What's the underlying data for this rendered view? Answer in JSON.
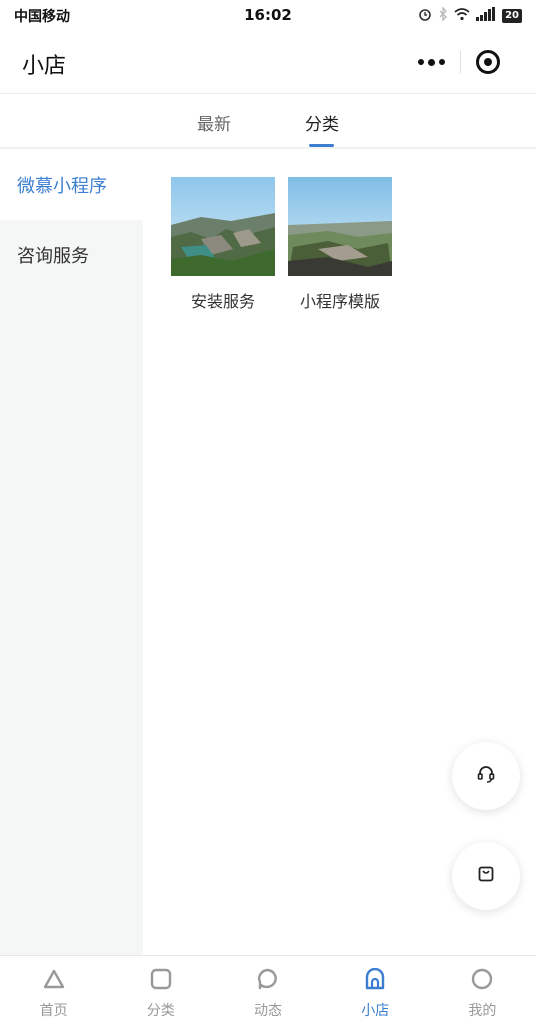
{
  "status_bar": {
    "carrier": "中国移动",
    "time": "16:02",
    "battery": "20"
  },
  "nav": {
    "title": "小店"
  },
  "tabs": [
    {
      "label": "最新"
    },
    {
      "label": "分类"
    }
  ],
  "active_tab": "分类",
  "sidebar": {
    "items": [
      {
        "label": "微慕小程序"
      },
      {
        "label": "咨询服务"
      }
    ]
  },
  "products": [
    {
      "label": "安装服务"
    },
    {
      "label": "小程序模版"
    }
  ],
  "floating": {
    "service_icon": "headset-icon",
    "cart_icon": "shopping-bag-icon"
  },
  "tabbar": {
    "items": [
      {
        "label": "首页",
        "icon": "triangle-icon"
      },
      {
        "label": "分类",
        "icon": "square-icon"
      },
      {
        "label": "动态",
        "icon": "speech-bubble-icon"
      },
      {
        "label": "小店",
        "icon": "shop-icon"
      },
      {
        "label": "我的",
        "icon": "profile-circle-icon"
      }
    ],
    "active_color": "#3c7fd0",
    "inactive_color": "#999999"
  },
  "colors": {
    "accent": "#3c7fd0",
    "sidebar_bg": "#f4f7f6"
  }
}
